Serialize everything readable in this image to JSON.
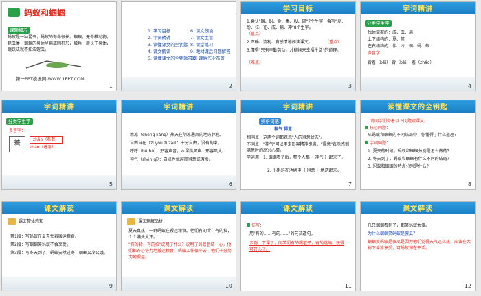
{
  "slides": [
    {
      "num": "1",
      "title": "蚂蚁和蝈蝈",
      "tag": "课题揭示",
      "text": "蚂蚁是一种昆虫，蚂蚁的寿命很长。蝈蝈，无脊椎动物，昆虫类，蝈蝈的身体呈扁或圆柱形，触角一般长于身体，跳跃法就不如法蝗虫。",
      "footer": "第一PPT模板网-WWW.1PPT.COM"
    },
    {
      "num": "2",
      "items": [
        "1. 学习目标",
        "2. 字词精讲",
        "3. 读懂课文的全钥匙",
        "4. 课文解读",
        "5. 读懂课文的全钥匙答案",
        "6. 课文朗诵",
        "7. 课文主旨",
        "8. 课堂练习",
        "9. 教材课后习题解答",
        "10. 课后作业布置"
      ]
    },
    {
      "num": "3",
      "title": "学习目标",
      "lines": [
        "1.会认\"蝈、蚂、食、集、股、部\"7个生字，会写\"夏、盼、拉、往、成、扁、冲\"8个生字。",
        "2.正确、流利、有感情地朗读课文。",
        "3.懂得\"只有辛勤劳动，才能换来幸福生活\"的道理。"
      ],
      "marks": [
        "（重点）",
        "（重点）",
        "（难点）"
      ]
    },
    {
      "num": "4",
      "title": "字词精讲",
      "tag": "分类学生字",
      "lines": [
        "独体掌握的：成、虫、扁",
        "上下结构的：夏、常",
        "左右结构的：伴、冷、蝈、蚂、蚁",
        "多音字：",
        "背着（bēi）  背（bèi）  着（zháo）"
      ]
    },
    {
      "num": "5",
      "title": "字词精讲",
      "tag": "分类学生字",
      "sub": "多音字：",
      "char": "着",
      "readings": [
        "zhāo（着数）",
        "zháo（着急）"
      ]
    },
    {
      "num": "6",
      "title": "字词精讲",
      "lines": [
        "乘凉（chéng liáng）热天在阴凉通风的地方休息。",
        "自由自在（zì yóu zì zài）：十分自由，没有拘束。",
        "呼呼（hū hū）：形容声音，本课指风声、形容风大。",
        "神气（shén qì）：自以为优越而得意或傲慢。"
      ]
    },
    {
      "num": "7",
      "title": "字词精讲",
      "tag": "辨析词语",
      "pair": "神气    得意",
      "lines": [
        "相同点：这两个词都表示\"人的得意状态\"。",
        "不同点：\"神气\"可以用来形容精神饱满，\"得意\"表示感到满意时的高兴心情。",
        "学运用：1. 蝈蝈看了后，整个人都（  神气  ）起来了。",
        "2. 小蝌蚪在池塘中（  得意  ）地游起来。"
      ]
    },
    {
      "num": "8",
      "title": "读懂课文的全钥匙",
      "lines": [
        "请同学们带着以下问题读课文。",
        "核心问题：",
        "从蚂蚁和蝈蝈的不同结局中，你懂得了什么道理？",
        "字词问题：",
        "1. 夏天的时候，蚂蚁和蝈蝈分别是怎么做的？",
        "2. 冬天到了，蚂蚁和蝈蝈有什么不同的结局？",
        "3. 蚂蚁和蝈蝈的特点分别是什么？"
      ]
    },
    {
      "num": "9",
      "title": "课文解读",
      "tag": "课文整体感知",
      "lines": [
        "第1段：写蚂蚁在夏天忙着搬运粮食。",
        "第2段：写蝈蝈笑蚂蚁不会享受。",
        "第3段：写冬天到了，蚂蚁安然过冬，蝈蝈又冷又饿。"
      ]
    },
    {
      "num": "10",
      "title": "课文解读",
      "tag": "课文理解品析",
      "lines": [
        "夏天真热，一群蚂蚁在搬运粮食。他们有的背，有的拉，个个满头大汗。",
        "\"有的背，有的拉\"说明了什么？说明了蚂蚁团结一心，他们都齐心协力地搬运粮食，蚂蚁工作很辛苦，他们十分努力地搬运。"
      ]
    },
    {
      "num": "11",
      "title": "课文解读",
      "tag": "仿写：",
      "lines": [
        "用\"有的……有的……\"的句式造句。",
        "示例：下课了，同学们有的踢毽子，有的跳绳，玩得可开心了。"
      ]
    },
    {
      "num": "12",
      "title": "课文解读",
      "lines": [
        "几只蝈蝈看到了，都笑蚂蚁太傻。",
        "为什么蝈蝈笑蚂蚁是傻瓜？",
        "蝈蝈笑蚂蚁是傻瓜是因为他们觉得天气这么热，应该在大树下乘凉享受，可蚂蚁却在干活。"
      ]
    }
  ],
  "colors": {
    "banner": "#2f9de0",
    "banner_text": "#ffe45c",
    "title_red": "#e42b1d",
    "body_blue": "#1d4fc2",
    "tag_green": "#2aa04a"
  }
}
